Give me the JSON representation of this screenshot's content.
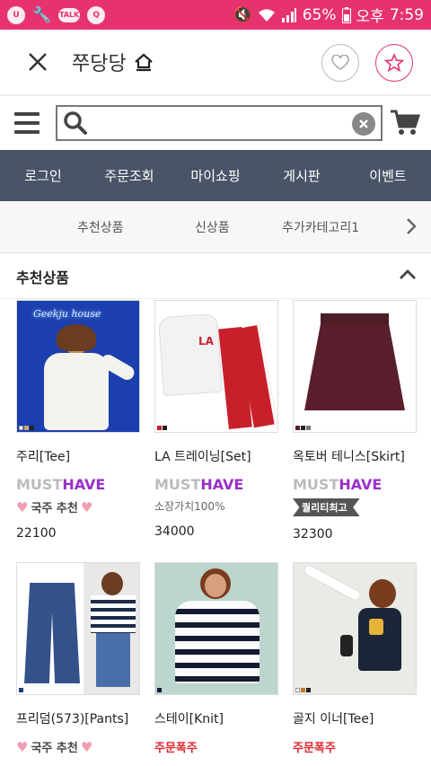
{
  "status": {
    "battery": "65%",
    "ampm": "오후",
    "time": "7:59",
    "talk": "TALK",
    "app_icon_1": "U",
    "app_icon_2": "Q"
  },
  "header": {
    "shop_name": "쭈당당"
  },
  "nav": [
    "로그인",
    "주문조회",
    "마이쇼핑",
    "게시판",
    "이벤트"
  ],
  "categories": [
    "추천상품",
    "신상품",
    "추가카테고리1"
  ],
  "section": {
    "title": "추천상품"
  },
  "thumb_text": {
    "neon": "Geekju house",
    "la": "LA"
  },
  "products": [
    {
      "name": "주리[Tee]",
      "must_a": "MUST",
      "must_b": "HAVE",
      "tag": "국주 추천",
      "price": "22100"
    },
    {
      "name": "LA 트레이닝[Set]",
      "must_a": "MUST",
      "must_b": "HAVE",
      "tag": "소장가치100%",
      "price": "34000"
    },
    {
      "name": "옥토버 테니스[Skirt]",
      "must_a": "MUST",
      "must_b": "HAVE",
      "tag": "퀄리티최고",
      "price": "32300"
    },
    {
      "name": "프리덤(573)[Pants]",
      "tag": "국주 추천"
    },
    {
      "name": "스테이[Knit]",
      "tag": "주문폭주"
    },
    {
      "name": "골지 이너[Tee]",
      "tag": "주문폭주"
    }
  ]
}
